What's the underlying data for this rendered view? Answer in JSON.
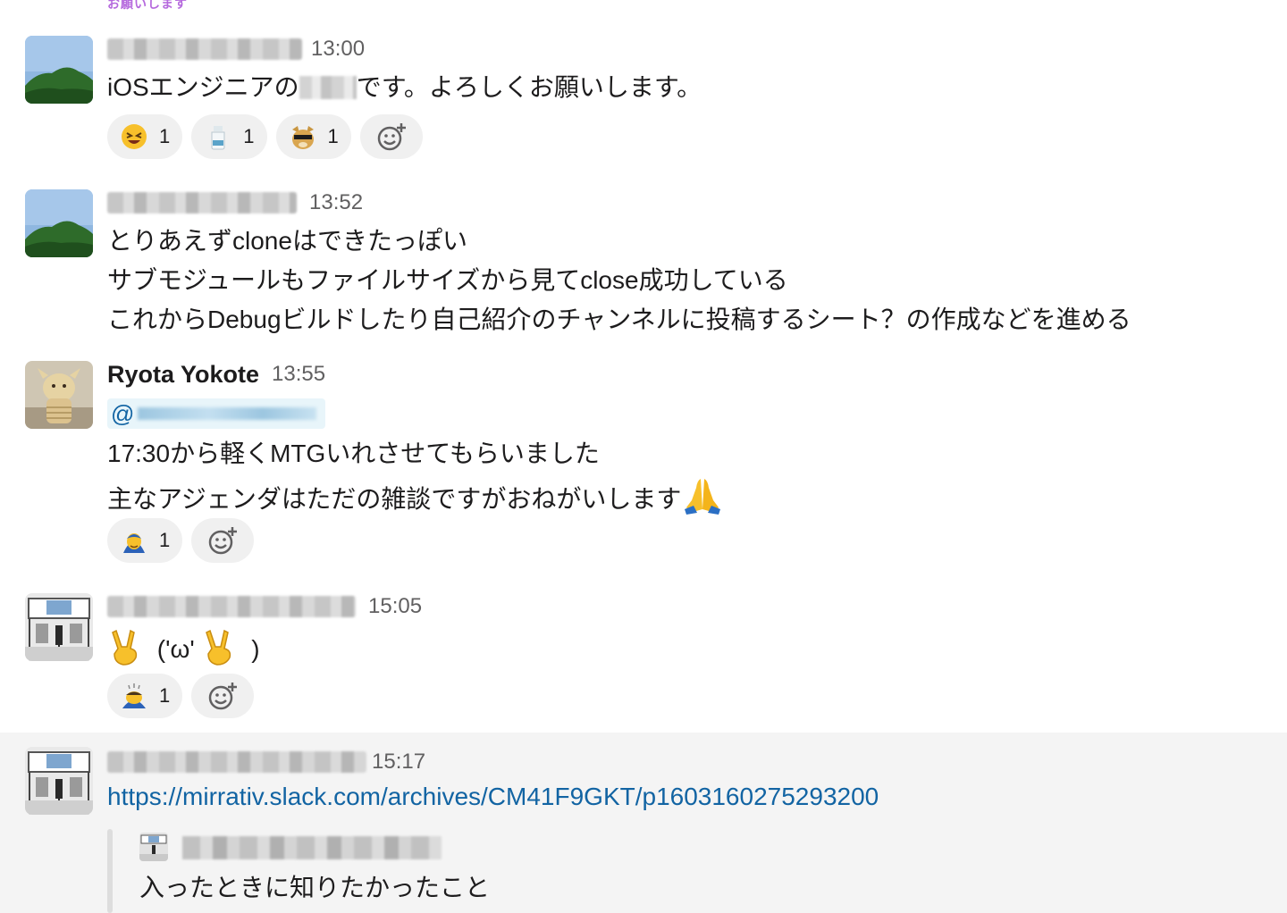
{
  "top_fragment": "お願いします",
  "messages": [
    {
      "time": "13:00",
      "lines": [
        "iOSエンジニアの",
        "です。よろしくお願いします。"
      ],
      "reactions": [
        {
          "icon": "laughing-emoji",
          "count": "1"
        },
        {
          "icon": "milk-bottle-emoji",
          "count": "1"
        },
        {
          "icon": "cool-doge-emoji",
          "count": "1"
        }
      ]
    },
    {
      "time": "13:52",
      "lines": [
        "とりあえずcloneはできたっぽい",
        "サブモジュールもファイルサイズから見てclose成功している",
        "これからDebugビルドしたり自己紹介のチャンネルに投稿するシート？の作成などを進める"
      ]
    },
    {
      "author": "Ryota Yokote",
      "time": "13:55",
      "mention_prefix": "@",
      "lines": [
        "17:30から軽くMTGいれさせてもらいました",
        "主なアジェンダはただの雑談ですがおねがいします"
      ],
      "trailing_emoji": "folded-hands-emoji",
      "reactions": [
        {
          "icon": "person-bowing-emoji",
          "count": "1"
        }
      ]
    },
    {
      "time": "15:05",
      "text_middle": "('ω'",
      "text_end": ")",
      "inline_emoji": "victory-hand-emoji",
      "reactions": [
        {
          "icon": "person-bowing-deeply-emoji",
          "count": "1"
        }
      ]
    },
    {
      "time": "15:17",
      "link": "https://mirrativ.slack.com/archives/CM41F9GKT/p1603160275293200",
      "quote_text": "入ったときに知りたかったこと"
    }
  ],
  "colors": {
    "link": "#1264a3",
    "reaction_bg": "#f0f0f0",
    "hover_row": "#f4f4f4",
    "timestamp": "#616061"
  },
  "icons": {
    "add_reaction": "add-reaction-icon"
  }
}
